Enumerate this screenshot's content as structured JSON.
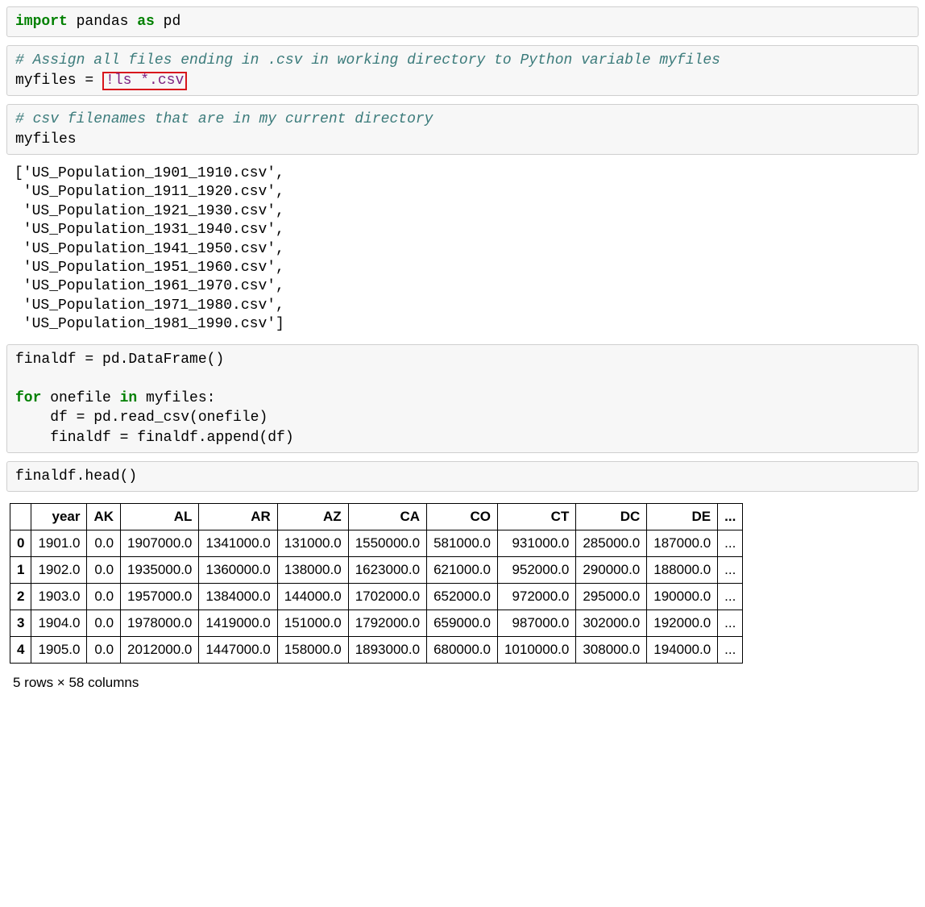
{
  "cells": {
    "c1": {
      "tokens": {
        "import": "import",
        "pandas": " pandas ",
        "as": "as",
        "pd": " pd"
      }
    },
    "c2": {
      "comment": "# Assign all files ending in .csv in working directory to Python variable myfiles",
      "assign": "myfiles = ",
      "magic": "!ls *.csv"
    },
    "c3": {
      "comment": "# csv filenames that are in my current directory",
      "line": "myfiles"
    },
    "out3": "['US_Population_1901_1910.csv',\n 'US_Population_1911_1920.csv',\n 'US_Population_1921_1930.csv',\n 'US_Population_1931_1940.csv',\n 'US_Population_1941_1950.csv',\n 'US_Population_1951_1960.csv',\n 'US_Population_1961_1970.csv',\n 'US_Population_1971_1980.csv',\n 'US_Population_1981_1990.csv']",
    "c4": {
      "l1": "finaldf = pd.DataFrame()",
      "blank": "",
      "for": "for",
      "for_rest": " onefile ",
      "in": "in",
      "in_rest": " myfiles:",
      "l3": "    df = pd.read_csv(onefile)",
      "l4": "    finaldf = finaldf.append(df)"
    },
    "c5": {
      "line": "finaldf.head()"
    }
  },
  "table": {
    "headers": [
      "",
      "year",
      "AK",
      "AL",
      "AR",
      "AZ",
      "CA",
      "CO",
      "CT",
      "DC",
      "DE",
      "..."
    ],
    "rows": [
      {
        "idx": "0",
        "cells": [
          "1901.0",
          "0.0",
          "1907000.0",
          "1341000.0",
          "131000.0",
          "1550000.0",
          "581000.0",
          "931000.0",
          "285000.0",
          "187000.0",
          "..."
        ]
      },
      {
        "idx": "1",
        "cells": [
          "1902.0",
          "0.0",
          "1935000.0",
          "1360000.0",
          "138000.0",
          "1623000.0",
          "621000.0",
          "952000.0",
          "290000.0",
          "188000.0",
          "..."
        ]
      },
      {
        "idx": "2",
        "cells": [
          "1903.0",
          "0.0",
          "1957000.0",
          "1384000.0",
          "144000.0",
          "1702000.0",
          "652000.0",
          "972000.0",
          "295000.0",
          "190000.0",
          "..."
        ]
      },
      {
        "idx": "3",
        "cells": [
          "1904.0",
          "0.0",
          "1978000.0",
          "1419000.0",
          "151000.0",
          "1792000.0",
          "659000.0",
          "987000.0",
          "302000.0",
          "192000.0",
          "..."
        ]
      },
      {
        "idx": "4",
        "cells": [
          "1905.0",
          "0.0",
          "2012000.0",
          "1447000.0",
          "158000.0",
          "1893000.0",
          "680000.0",
          "1010000.0",
          "308000.0",
          "194000.0",
          "..."
        ]
      }
    ],
    "caption": "5 rows × 58 columns"
  }
}
